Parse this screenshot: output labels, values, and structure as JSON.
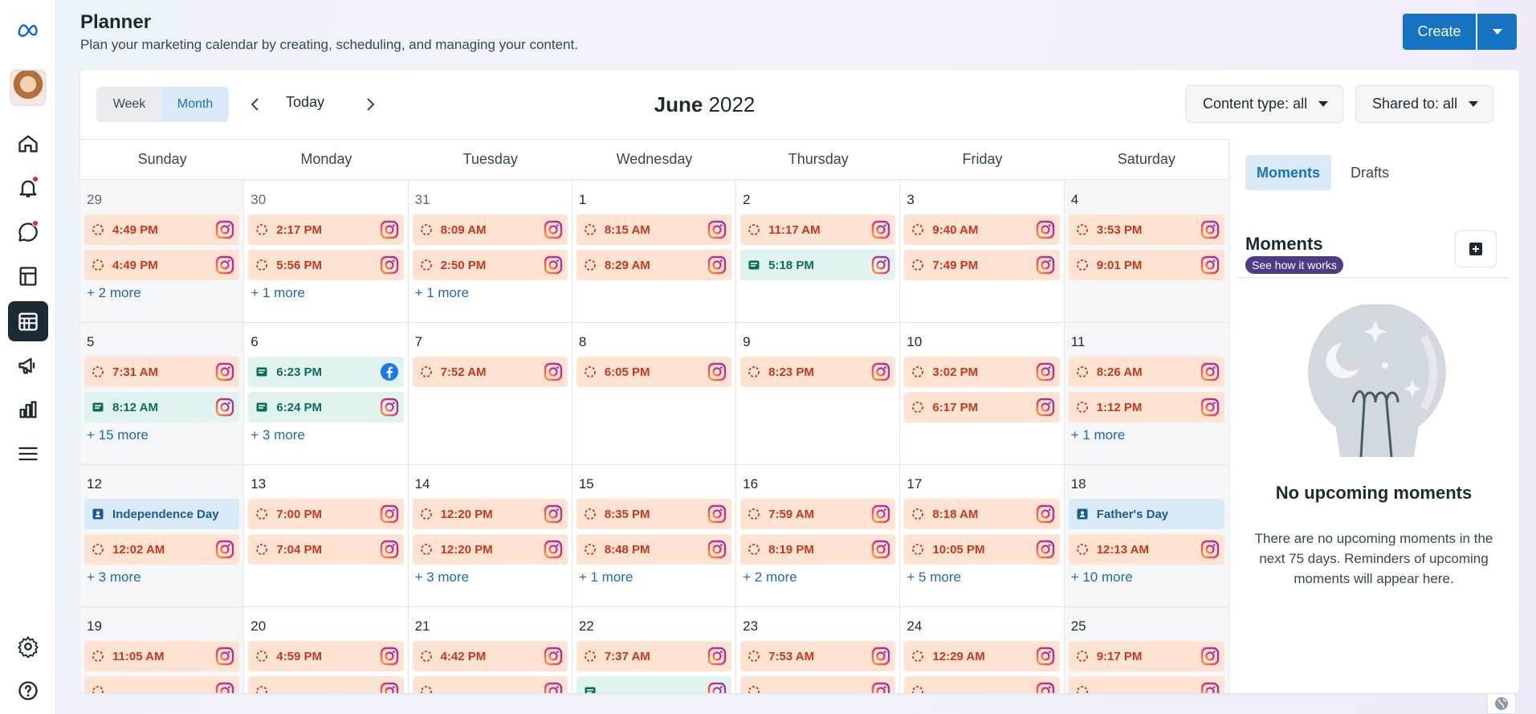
{
  "header": {
    "title": "Planner",
    "subtitle": "Plan your marketing calendar by creating, scheduling, and managing your content.",
    "create_label": "Create"
  },
  "toolbar": {
    "week_label": "Week",
    "month_label": "Month",
    "today_label": "Today",
    "month_name": "June",
    "year": "2022",
    "content_filter": "Content type: all",
    "shared_filter": "Shared to: all"
  },
  "weekdays": [
    "Sunday",
    "Monday",
    "Tuesday",
    "Wednesday",
    "Thursday",
    "Friday",
    "Saturday"
  ],
  "weeks": [
    [
      {
        "day": "29",
        "dim": true,
        "events": [
          {
            "time": "4:49 PM",
            "kind": "ig"
          },
          {
            "time": "4:49 PM",
            "kind": "ig"
          }
        ],
        "more": "+ 2 more"
      },
      {
        "day": "30",
        "dim": true,
        "events": [
          {
            "time": "2:17 PM",
            "kind": "ig"
          },
          {
            "time": "5:56 PM",
            "kind": "ig"
          }
        ],
        "more": "+ 1 more"
      },
      {
        "day": "31",
        "dim": true,
        "events": [
          {
            "time": "8:09 AM",
            "kind": "ig"
          },
          {
            "time": "2:50 PM",
            "kind": "ig"
          }
        ],
        "more": "+ 1 more"
      },
      {
        "day": "1",
        "events": [
          {
            "time": "8:15 AM",
            "kind": "ig"
          },
          {
            "time": "8:29 AM",
            "kind": "ig"
          }
        ],
        "more": ""
      },
      {
        "day": "2",
        "events": [
          {
            "time": "11:17 AM",
            "kind": "ig"
          },
          {
            "time": "5:18 PM",
            "kind": "post"
          }
        ],
        "more": ""
      },
      {
        "day": "3",
        "events": [
          {
            "time": "9:40 AM",
            "kind": "ig"
          },
          {
            "time": "7:49 PM",
            "kind": "ig"
          }
        ],
        "more": ""
      },
      {
        "day": "4",
        "events": [
          {
            "time": "3:53 PM",
            "kind": "ig"
          },
          {
            "time": "9:01 PM",
            "kind": "ig"
          }
        ],
        "more": ""
      }
    ],
    [
      {
        "day": "5",
        "events": [
          {
            "time": "7:31 AM",
            "kind": "ig"
          },
          {
            "time": "8:12 AM",
            "kind": "post"
          }
        ],
        "more": "+ 15 more"
      },
      {
        "day": "6",
        "events": [
          {
            "time": "6:23 PM",
            "kind": "fbpost"
          },
          {
            "time": "6:24 PM",
            "kind": "post"
          }
        ],
        "more": "+ 3 more"
      },
      {
        "day": "7",
        "events": [
          {
            "time": "7:52 AM",
            "kind": "ig"
          }
        ],
        "more": ""
      },
      {
        "day": "8",
        "events": [
          {
            "time": "6:05 PM",
            "kind": "ig"
          }
        ],
        "more": ""
      },
      {
        "day": "9",
        "events": [
          {
            "time": "8:23 PM",
            "kind": "ig"
          }
        ],
        "more": ""
      },
      {
        "day": "10",
        "events": [
          {
            "time": "3:02 PM",
            "kind": "ig"
          },
          {
            "time": "6:17 PM",
            "kind": "ig"
          }
        ],
        "more": ""
      },
      {
        "day": "11",
        "events": [
          {
            "time": "8:26 AM",
            "kind": "ig"
          },
          {
            "time": "1:12 PM",
            "kind": "ig"
          }
        ],
        "more": "+ 1 more"
      }
    ],
    [
      {
        "day": "12",
        "events": [
          {
            "time": "Independence Day",
            "kind": "moment"
          },
          {
            "time": "12:02 AM",
            "kind": "ig"
          }
        ],
        "more": "+ 3 more"
      },
      {
        "day": "13",
        "events": [
          {
            "time": "7:00 PM",
            "kind": "ig"
          },
          {
            "time": "7:04 PM",
            "kind": "ig"
          }
        ],
        "more": ""
      },
      {
        "day": "14",
        "events": [
          {
            "time": "12:20 PM",
            "kind": "ig"
          },
          {
            "time": "12:20 PM",
            "kind": "ig"
          }
        ],
        "more": "+ 3 more"
      },
      {
        "day": "15",
        "events": [
          {
            "time": "8:35 PM",
            "kind": "ig"
          },
          {
            "time": "8:48 PM",
            "kind": "ig"
          }
        ],
        "more": "+ 1 more"
      },
      {
        "day": "16",
        "events": [
          {
            "time": "7:59 AM",
            "kind": "ig"
          },
          {
            "time": "8:19 PM",
            "kind": "ig"
          }
        ],
        "more": "+ 2 more"
      },
      {
        "day": "17",
        "events": [
          {
            "time": "8:18 AM",
            "kind": "ig"
          },
          {
            "time": "10:05 PM",
            "kind": "ig"
          }
        ],
        "more": "+ 5 more"
      },
      {
        "day": "18",
        "events": [
          {
            "time": "Father's Day",
            "kind": "moment"
          },
          {
            "time": "12:13 AM",
            "kind": "ig"
          }
        ],
        "more": "+ 10 more"
      }
    ],
    [
      {
        "day": "19",
        "events": [
          {
            "time": "11:05 AM",
            "kind": "ig"
          },
          {
            "time": "",
            "kind": "ig"
          }
        ],
        "more": ""
      },
      {
        "day": "20",
        "events": [
          {
            "time": "4:59 PM",
            "kind": "ig"
          },
          {
            "time": "",
            "kind": "ig"
          }
        ],
        "more": ""
      },
      {
        "day": "21",
        "events": [
          {
            "time": "4:42 PM",
            "kind": "ig"
          },
          {
            "time": "",
            "kind": "ig"
          }
        ],
        "more": ""
      },
      {
        "day": "22",
        "events": [
          {
            "time": "7:37 AM",
            "kind": "ig"
          },
          {
            "time": "",
            "kind": "post"
          }
        ],
        "more": ""
      },
      {
        "day": "23",
        "events": [
          {
            "time": "7:53 AM",
            "kind": "ig"
          },
          {
            "time": "",
            "kind": "ig"
          }
        ],
        "more": ""
      },
      {
        "day": "24",
        "events": [
          {
            "time": "12:29 AM",
            "kind": "ig"
          },
          {
            "time": "",
            "kind": "ig"
          }
        ],
        "more": ""
      },
      {
        "day": "25",
        "events": [
          {
            "time": "9:17 PM",
            "kind": "ig"
          },
          {
            "time": "",
            "kind": "ig"
          }
        ],
        "more": ""
      }
    ]
  ],
  "side": {
    "tab_moments": "Moments",
    "tab_drafts": "Drafts",
    "moments_title": "Moments",
    "see_how": "See how it works",
    "empty_title": "No upcoming moments",
    "empty_text": "There are no upcoming moments in the next 75 days. Reminders of upcoming moments will appear here."
  },
  "icons": {
    "logo": "meta-logo-icon",
    "rail": [
      "home-icon",
      "bell-icon",
      "chat-icon",
      "pages-icon",
      "calendar-icon",
      "megaphone-icon",
      "insights-icon",
      "menu-icon",
      "gear-icon",
      "help-icon"
    ]
  },
  "colors": {
    "accent": "#1573c2",
    "instagram_event_bg": "#ffe3d2",
    "post_event_bg": "#e1f3ee",
    "moment_event_bg": "#dbeaf7"
  }
}
